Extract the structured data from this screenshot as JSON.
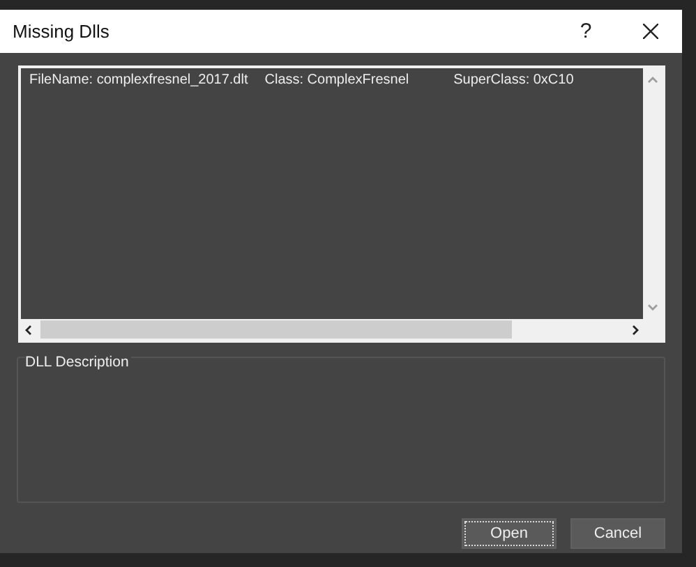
{
  "window": {
    "title": "Missing Dlls",
    "help": "?"
  },
  "list": {
    "rows": [
      {
        "file_name": "FileName:  complexfresnel_2017.dlt",
        "class": "Class: ComplexFresnel",
        "super_class": "SuperClass: 0xC10",
        "selected": false
      }
    ]
  },
  "description": {
    "label": "DLL Description"
  },
  "buttons": [
    {
      "label": "Open",
      "focused": true
    },
    {
      "label": "Cancel",
      "focused": false
    }
  ]
}
